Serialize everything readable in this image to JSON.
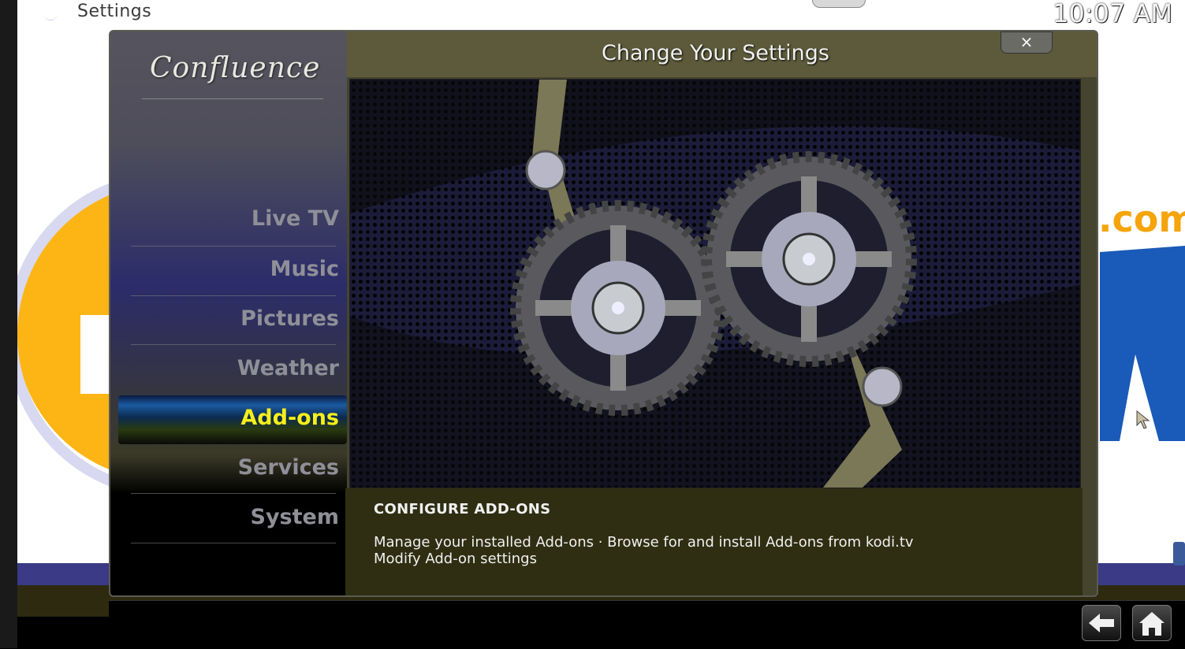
{
  "top_bar": {
    "window_title": "Settings",
    "clock": "10:07 AM"
  },
  "background": {
    "domain_fragment": ".com"
  },
  "dialog": {
    "brand": "Confluence",
    "title": "Change Your Settings",
    "close_label": "×",
    "menu": [
      {
        "label": "Live TV",
        "active": false
      },
      {
        "label": "Music",
        "active": false
      },
      {
        "label": "Pictures",
        "active": false
      },
      {
        "label": "Weather",
        "active": false
      },
      {
        "label": "Add-ons",
        "active": true
      },
      {
        "label": "Services",
        "active": false
      },
      {
        "label": "System",
        "active": false
      }
    ],
    "description": {
      "heading": "CONFIGURE ADD-ONS",
      "line1": "Manage your installed Add-ons · Browse for and install Add-ons from kodi.tv",
      "line2": "Modify Add-on settings"
    }
  },
  "bottom_bar": {
    "back_icon": "back-arrow-icon",
    "home_icon": "home-icon"
  },
  "colors": {
    "active_menu": "#f5ee1a",
    "inactive_menu": "#8f8f98",
    "panel": "#2f2e12"
  }
}
